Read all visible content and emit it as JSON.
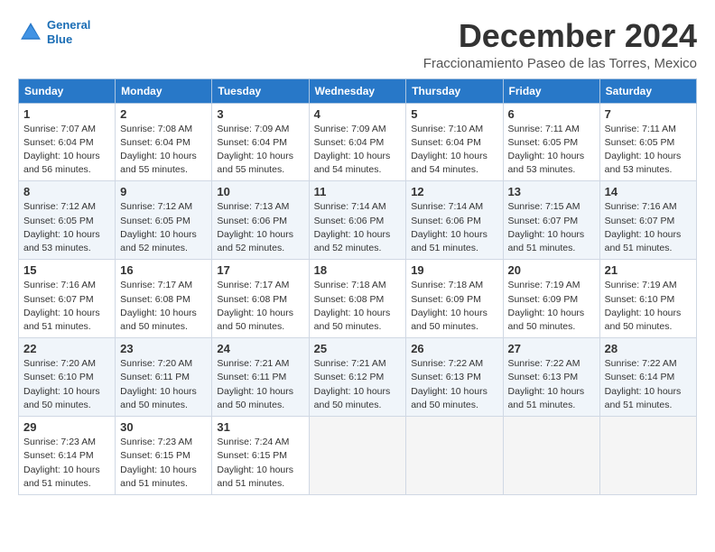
{
  "logo": {
    "line1": "General",
    "line2": "Blue"
  },
  "title": "December 2024",
  "location": "Fraccionamiento Paseo de las Torres, Mexico",
  "headers": [
    "Sunday",
    "Monday",
    "Tuesday",
    "Wednesday",
    "Thursday",
    "Friday",
    "Saturday"
  ],
  "weeks": [
    [
      {
        "day": "1",
        "info": "Sunrise: 7:07 AM\nSunset: 6:04 PM\nDaylight: 10 hours\nand 56 minutes."
      },
      {
        "day": "2",
        "info": "Sunrise: 7:08 AM\nSunset: 6:04 PM\nDaylight: 10 hours\nand 55 minutes."
      },
      {
        "day": "3",
        "info": "Sunrise: 7:09 AM\nSunset: 6:04 PM\nDaylight: 10 hours\nand 55 minutes."
      },
      {
        "day": "4",
        "info": "Sunrise: 7:09 AM\nSunset: 6:04 PM\nDaylight: 10 hours\nand 54 minutes."
      },
      {
        "day": "5",
        "info": "Sunrise: 7:10 AM\nSunset: 6:04 PM\nDaylight: 10 hours\nand 54 minutes."
      },
      {
        "day": "6",
        "info": "Sunrise: 7:11 AM\nSunset: 6:05 PM\nDaylight: 10 hours\nand 53 minutes."
      },
      {
        "day": "7",
        "info": "Sunrise: 7:11 AM\nSunset: 6:05 PM\nDaylight: 10 hours\nand 53 minutes."
      }
    ],
    [
      {
        "day": "8",
        "info": "Sunrise: 7:12 AM\nSunset: 6:05 PM\nDaylight: 10 hours\nand 53 minutes."
      },
      {
        "day": "9",
        "info": "Sunrise: 7:12 AM\nSunset: 6:05 PM\nDaylight: 10 hours\nand 52 minutes."
      },
      {
        "day": "10",
        "info": "Sunrise: 7:13 AM\nSunset: 6:06 PM\nDaylight: 10 hours\nand 52 minutes."
      },
      {
        "day": "11",
        "info": "Sunrise: 7:14 AM\nSunset: 6:06 PM\nDaylight: 10 hours\nand 52 minutes."
      },
      {
        "day": "12",
        "info": "Sunrise: 7:14 AM\nSunset: 6:06 PM\nDaylight: 10 hours\nand 51 minutes."
      },
      {
        "day": "13",
        "info": "Sunrise: 7:15 AM\nSunset: 6:07 PM\nDaylight: 10 hours\nand 51 minutes."
      },
      {
        "day": "14",
        "info": "Sunrise: 7:16 AM\nSunset: 6:07 PM\nDaylight: 10 hours\nand 51 minutes."
      }
    ],
    [
      {
        "day": "15",
        "info": "Sunrise: 7:16 AM\nSunset: 6:07 PM\nDaylight: 10 hours\nand 51 minutes."
      },
      {
        "day": "16",
        "info": "Sunrise: 7:17 AM\nSunset: 6:08 PM\nDaylight: 10 hours\nand 50 minutes."
      },
      {
        "day": "17",
        "info": "Sunrise: 7:17 AM\nSunset: 6:08 PM\nDaylight: 10 hours\nand 50 minutes."
      },
      {
        "day": "18",
        "info": "Sunrise: 7:18 AM\nSunset: 6:08 PM\nDaylight: 10 hours\nand 50 minutes."
      },
      {
        "day": "19",
        "info": "Sunrise: 7:18 AM\nSunset: 6:09 PM\nDaylight: 10 hours\nand 50 minutes."
      },
      {
        "day": "20",
        "info": "Sunrise: 7:19 AM\nSunset: 6:09 PM\nDaylight: 10 hours\nand 50 minutes."
      },
      {
        "day": "21",
        "info": "Sunrise: 7:19 AM\nSunset: 6:10 PM\nDaylight: 10 hours\nand 50 minutes."
      }
    ],
    [
      {
        "day": "22",
        "info": "Sunrise: 7:20 AM\nSunset: 6:10 PM\nDaylight: 10 hours\nand 50 minutes."
      },
      {
        "day": "23",
        "info": "Sunrise: 7:20 AM\nSunset: 6:11 PM\nDaylight: 10 hours\nand 50 minutes."
      },
      {
        "day": "24",
        "info": "Sunrise: 7:21 AM\nSunset: 6:11 PM\nDaylight: 10 hours\nand 50 minutes."
      },
      {
        "day": "25",
        "info": "Sunrise: 7:21 AM\nSunset: 6:12 PM\nDaylight: 10 hours\nand 50 minutes."
      },
      {
        "day": "26",
        "info": "Sunrise: 7:22 AM\nSunset: 6:13 PM\nDaylight: 10 hours\nand 50 minutes."
      },
      {
        "day": "27",
        "info": "Sunrise: 7:22 AM\nSunset: 6:13 PM\nDaylight: 10 hours\nand 51 minutes."
      },
      {
        "day": "28",
        "info": "Sunrise: 7:22 AM\nSunset: 6:14 PM\nDaylight: 10 hours\nand 51 minutes."
      }
    ],
    [
      {
        "day": "29",
        "info": "Sunrise: 7:23 AM\nSunset: 6:14 PM\nDaylight: 10 hours\nand 51 minutes."
      },
      {
        "day": "30",
        "info": "Sunrise: 7:23 AM\nSunset: 6:15 PM\nDaylight: 10 hours\nand 51 minutes."
      },
      {
        "day": "31",
        "info": "Sunrise: 7:24 AM\nSunset: 6:15 PM\nDaylight: 10 hours\nand 51 minutes."
      },
      {
        "day": "",
        "info": ""
      },
      {
        "day": "",
        "info": ""
      },
      {
        "day": "",
        "info": ""
      },
      {
        "day": "",
        "info": ""
      }
    ]
  ]
}
